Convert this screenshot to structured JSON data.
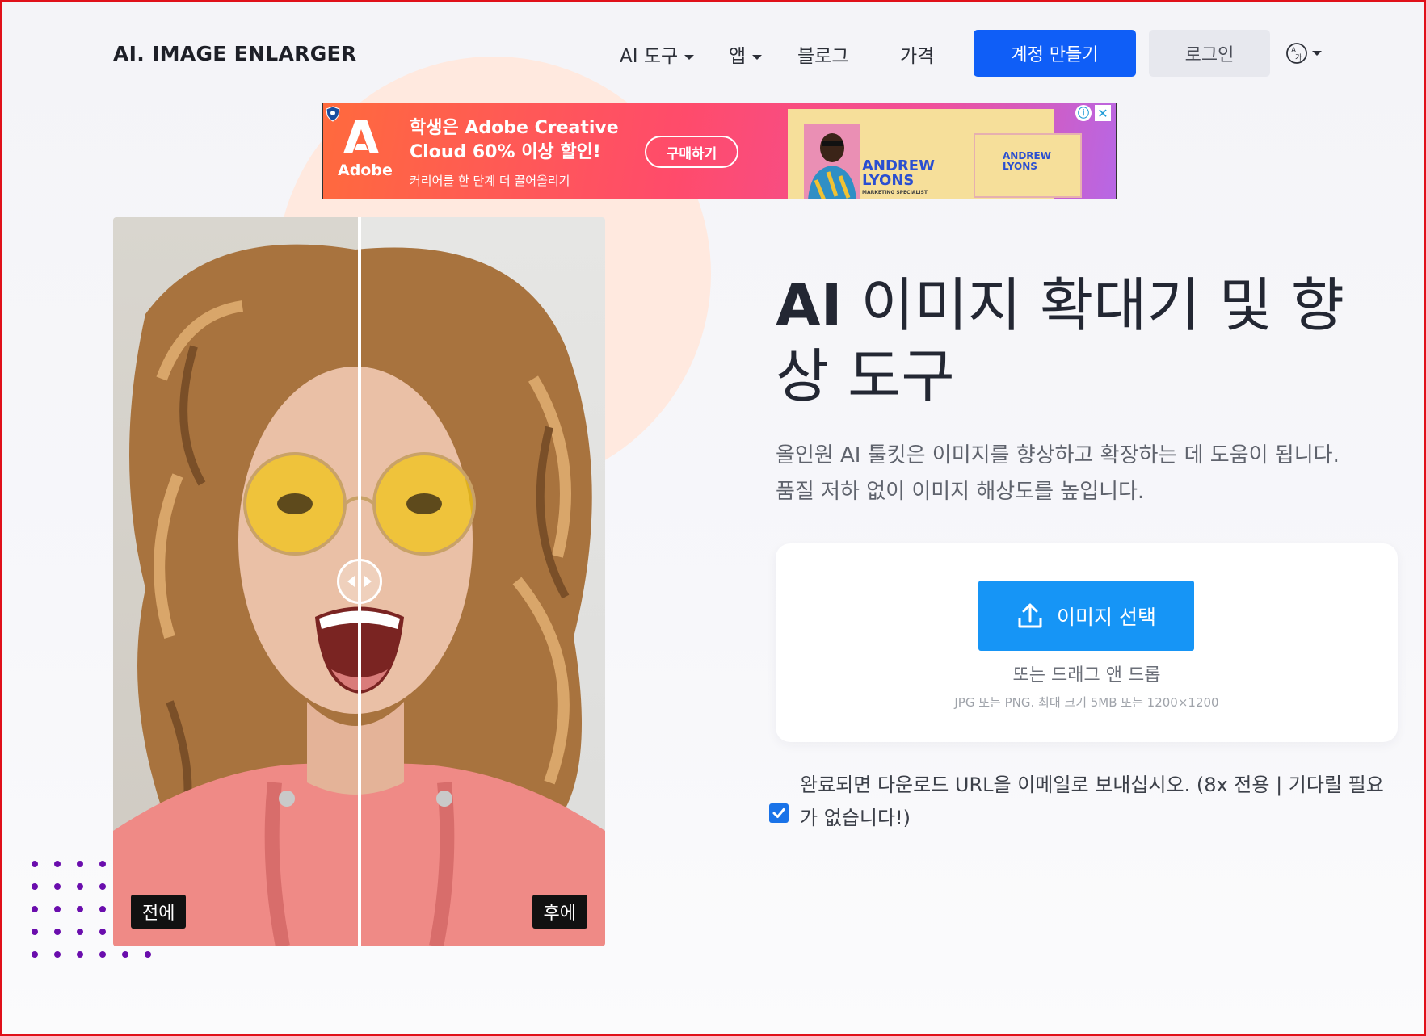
{
  "header": {
    "logo": "AI. IMAGE ENLARGER",
    "nav": {
      "ai_tools": "AI 도구",
      "apps": "앱",
      "blog": "블로그",
      "pricing": "가격"
    },
    "signup_label": "계정 만들기",
    "login_label": "로그인",
    "language_icon": "translate-icon"
  },
  "ad": {
    "brand": "Adobe",
    "headline": "학생은 Adobe Creative Cloud 60% 이상 할인!",
    "subtext": "커리어를 한 단계 더 끌어올리기",
    "cta": "구매하기",
    "card_name_1": "ANDREW",
    "card_name_2": "LYONS",
    "card_role": "MARKETING SPECIALIST",
    "info_icon": "ⓘ",
    "close_icon": "✕"
  },
  "compare": {
    "before_label": "전에",
    "after_label": "후에"
  },
  "hero": {
    "title_ai": "AI",
    "title_rest": "이미지 확대기 및 향상 도구",
    "description_line1": "올인원 AI 툴킷은 이미지를 향상하고 확장하는 데 도움이 됩니다.",
    "description_line2": "품질 저하 없이 이미지 해상도를 높입니다."
  },
  "upload": {
    "button_label": "이미지 선택",
    "drag_text": "또는 드래그 앤 드롭",
    "limit_text": "JPG 또는 PNG. 최대 크기 5MB 또는 1200×1200"
  },
  "email_option": {
    "checked": true,
    "text": "완료되면 다운로드 URL을 이메일로 보내십시오. (8x 전용 | 기다릴 필요가 없습니다!)"
  },
  "colors": {
    "primary": "#0f5ef7",
    "upload_button": "#1695f6",
    "accent_circle": "#ffe9df",
    "dots": "#6a0dad"
  }
}
